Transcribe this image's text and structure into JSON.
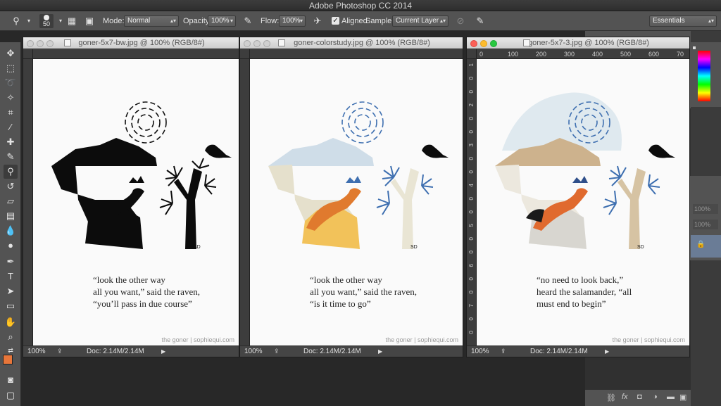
{
  "app": {
    "title": "Adobe Photoshop CC 2014"
  },
  "options_bar": {
    "brush_size": "50",
    "mode_label": "Mode:",
    "mode_value": "Normal",
    "opacity_label": "Opacity:",
    "opacity_value": "100%",
    "flow_label": "Flow:",
    "flow_value": "100%",
    "aligned_label": "Aligned",
    "sample_label": "Sample:",
    "sample_value": "Current Layer",
    "workspace_value": "Essentials"
  },
  "colors": {
    "foreground": "#e8763a",
    "background": "#ffffff",
    "chrome": "#535353",
    "accent_orange": "#e07a2e",
    "accent_blue": "#3f6fb0"
  },
  "documents": [
    {
      "title": "goner-5x7-bw.jpg @ 100% (RGB/8#)",
      "zoom": "100%",
      "doc_info": "Doc: 2.14M/2.14M",
      "signature": "SD",
      "poem": [
        "“look the other way",
        "all you want,” said the raven,",
        "“you’ll pass in due course”"
      ],
      "credit": "the goner | sophiequi.com",
      "active": false
    },
    {
      "title": "goner-colorstudy.jpg @ 100% (RGB/8#)",
      "zoom": "100%",
      "doc_info": "Doc: 2.14M/2.14M",
      "signature": "SD",
      "poem": [
        "“look the other way",
        "all you want,” said the raven,",
        "“is it time to go”"
      ],
      "credit": "the goner | sophiequi.com",
      "active": false
    },
    {
      "title": "goner-5x7-3.jpg @ 100% (RGB/8#)",
      "zoom": "100%",
      "doc_info": "Doc: 2.14M/2.14M",
      "signature": "SD",
      "poem": [
        "“no need to look back,”",
        "heard the salamander, “all",
        "must end to begin”"
      ],
      "credit": "the goner | sophiequi.com",
      "active": true,
      "ruler_ticks": [
        "0",
        "100",
        "200",
        "300",
        "400",
        "500",
        "600",
        "70"
      ],
      "ruler_left_ticks": [
        "1",
        "0",
        "0",
        "2",
        "0",
        "0",
        "3",
        "0",
        "0",
        "4",
        "0",
        "0",
        "5",
        "0",
        "0",
        "6",
        "0",
        "0",
        "7",
        "0",
        "0"
      ]
    }
  ],
  "panels": {
    "opacity_values": [
      "100%",
      "100%"
    ]
  }
}
